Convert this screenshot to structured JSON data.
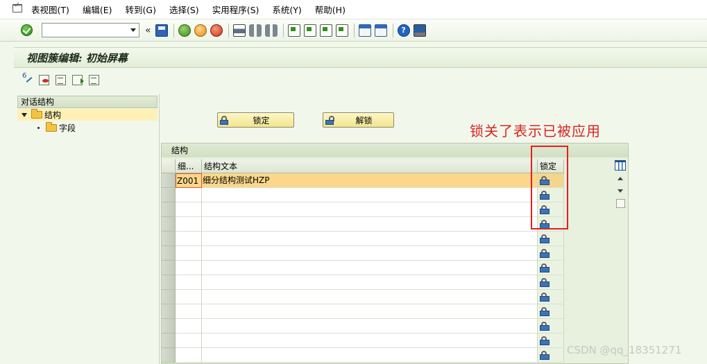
{
  "menu": [
    "表视图(T)",
    "编辑(E)",
    "转到(G)",
    "选择(S)",
    "实用程序(S)",
    "系统(Y)",
    "帮助(H)"
  ],
  "command_field": {
    "value": ""
  },
  "title": "视图簇编辑: 初始屏幕",
  "tree": {
    "header": "对话结构",
    "nodes": [
      {
        "label": "结构",
        "selected": true
      },
      {
        "label": "字段",
        "selected": false
      }
    ]
  },
  "buttons": {
    "lock": "锁定",
    "unlock": "解锁"
  },
  "annotation": "锁关了表示已被应用",
  "table": {
    "caption": "结构",
    "columns": [
      "细...",
      "结构文本",
      "锁定"
    ],
    "rows": [
      {
        "code": "Z001",
        "text": "细分结构测试HZP"
      },
      {
        "code": "",
        "text": ""
      },
      {
        "code": "",
        "text": ""
      },
      {
        "code": "",
        "text": ""
      },
      {
        "code": "",
        "text": ""
      },
      {
        "code": "",
        "text": ""
      },
      {
        "code": "",
        "text": ""
      },
      {
        "code": "",
        "text": ""
      },
      {
        "code": "",
        "text": ""
      },
      {
        "code": "",
        "text": ""
      },
      {
        "code": "",
        "text": ""
      },
      {
        "code": "",
        "text": ""
      },
      {
        "code": "",
        "text": ""
      }
    ]
  },
  "watermark": "CSDN @qq_18351271",
  "colors": {
    "accent_red": "#d8261f",
    "row_highlight": "#fbd78c",
    "lock_blue": "#3b73b9"
  }
}
